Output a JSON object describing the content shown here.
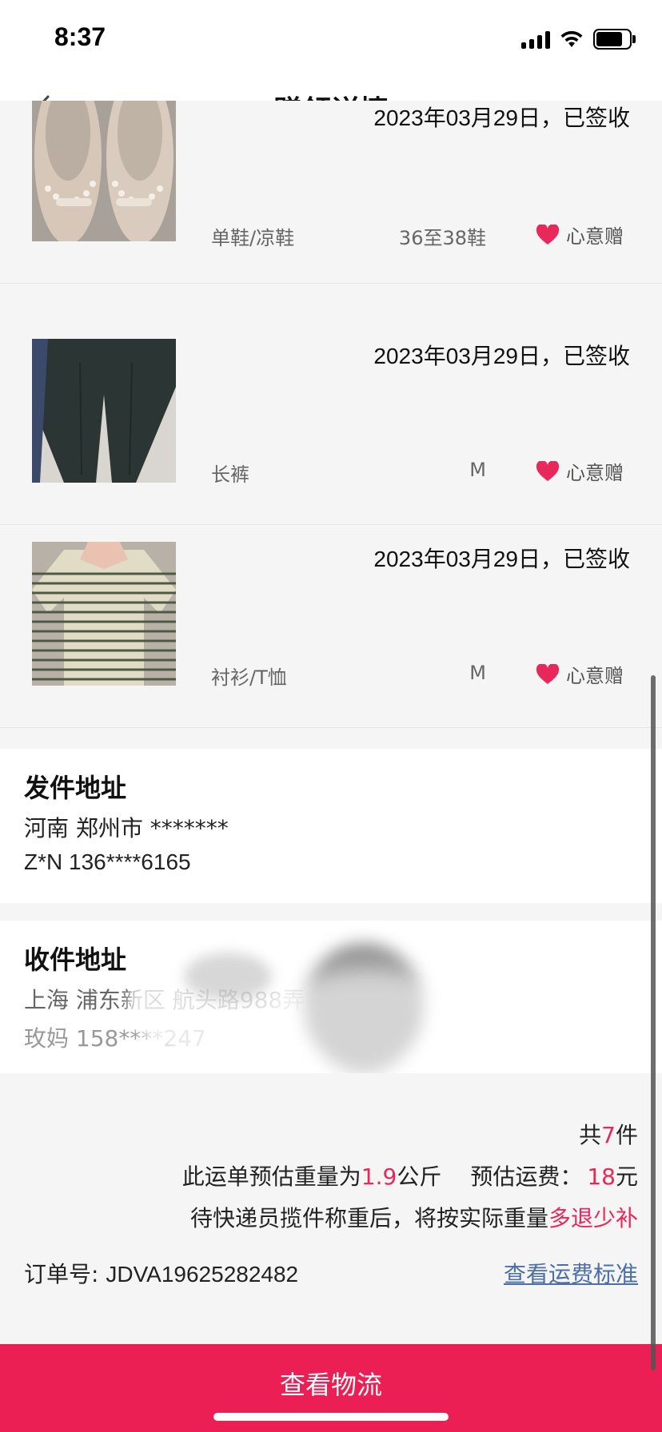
{
  "status_bar": {
    "time": "8:37"
  },
  "header": {
    "title": "赠领详情",
    "back_icon": "chevron-left-icon"
  },
  "items": [
    {
      "date_status": "2023年03月29日，已签收",
      "category": "单鞋/凉鞋",
      "size": "36至38鞋",
      "gift_label": "心意赠",
      "thumb": "shoes-photo"
    },
    {
      "date_status": "2023年03月29日，已签收",
      "category": "长裤",
      "size": "M",
      "gift_label": "心意赠",
      "thumb": "pants-photo"
    },
    {
      "date_status": "2023年03月29日，已签收",
      "category": "衬衫/T恤",
      "size": "M",
      "gift_label": "心意赠",
      "thumb": "striped-shirt-photo"
    }
  ],
  "sender": {
    "title": "发件地址",
    "address": "河南 郑州市 *******",
    "contact": "Z*N 136****6165"
  },
  "receiver": {
    "title": "收件地址",
    "address": "上海 浦东新区 航头路988弄",
    "contact": "玫妈 158****247"
  },
  "summary": {
    "count_prefix": "共",
    "count": "7",
    "count_suffix": "件",
    "weight_prefix": "此运单预估重量为",
    "weight": "1.9",
    "weight_unit": "公斤",
    "fee_label": "预估运费：",
    "fee": "18",
    "fee_unit": "元",
    "note_prefix": "待快递员揽件称重后，将按实际重量",
    "note_highlight": "多退少补",
    "order_label": "订单号: ",
    "order_no": "JDVA19625282482",
    "fee_link": "查看运费标准"
  },
  "bottom_button": {
    "label": "查看物流"
  },
  "colors": {
    "accent": "#eb1f53",
    "highlight_text": "#e8285a",
    "link": "#4d6fa8",
    "heart": "#e8285a"
  }
}
